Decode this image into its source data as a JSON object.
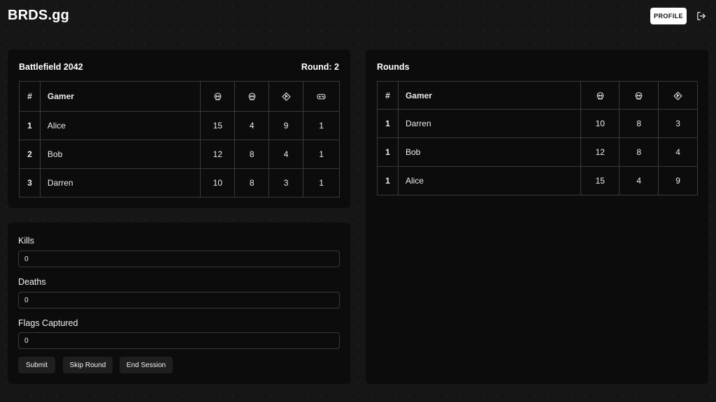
{
  "header": {
    "logo": "BRDS.gg",
    "profile_label": "PROFILE",
    "logout_icon": "logout-icon"
  },
  "game": {
    "title": "Battlefield 2042",
    "round_label": "Round: 2",
    "columns": {
      "rank": "#",
      "gamer": "Gamer",
      "icons": [
        "skull-icon",
        "skull-icon",
        "diamond-flag-icon",
        "gamepad-icon"
      ]
    },
    "rows": [
      {
        "rank": "1",
        "gamer": "Alice",
        "kills": "15",
        "deaths": "4",
        "flags": "9",
        "games": "1"
      },
      {
        "rank": "2",
        "gamer": "Bob",
        "kills": "12",
        "deaths": "8",
        "flags": "4",
        "games": "1"
      },
      {
        "rank": "3",
        "gamer": "Darren",
        "kills": "10",
        "deaths": "8",
        "flags": "3",
        "games": "1"
      }
    ]
  },
  "form": {
    "kills_label": "Kills",
    "kills_value": "0",
    "deaths_label": "Deaths",
    "deaths_value": "0",
    "flags_label": "Flags Captured",
    "flags_value": "0",
    "submit_label": "Submit",
    "skip_label": "Skip Round",
    "end_label": "End Session"
  },
  "rounds": {
    "title": "Rounds",
    "columns": {
      "rank": "#",
      "gamer": "Gamer",
      "icons": [
        "skull-icon",
        "skull-icon",
        "diamond-flag-icon"
      ]
    },
    "rows": [
      {
        "rank": "1",
        "gamer": "Darren",
        "kills": "10",
        "deaths": "8",
        "flags": "3"
      },
      {
        "rank": "1",
        "gamer": "Bob",
        "kills": "12",
        "deaths": "8",
        "flags": "4"
      },
      {
        "rank": "1",
        "gamer": "Alice",
        "kills": "15",
        "deaths": "4",
        "flags": "9"
      }
    ]
  }
}
